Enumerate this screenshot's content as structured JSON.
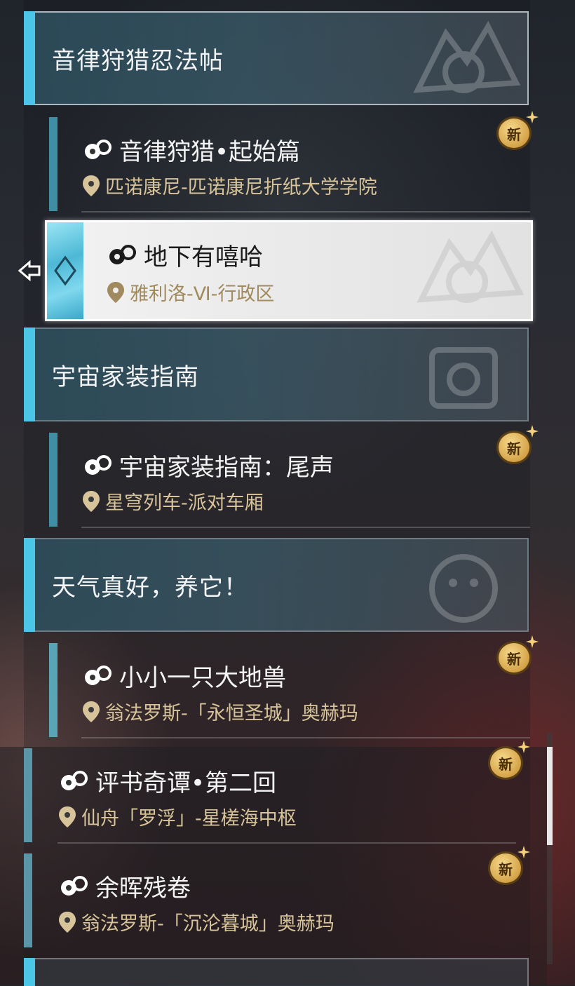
{
  "groups": [
    {
      "title": "音律狩猎忍法帖"
    },
    {
      "title": "宇宙家装指南"
    },
    {
      "title": "天气真好，养它！"
    }
  ],
  "missions": [
    {
      "name": "音律狩猎•起始篇",
      "location": "匹诺康尼-匹诺康尼折纸大学学院",
      "badge": "新"
    },
    {
      "name": "地下有嘻哈",
      "location": "雅利洛-Ⅵ-行政区",
      "badge": ""
    },
    {
      "name": "宇宙家装指南：尾声",
      "location": "星穹列车-派对车厢",
      "badge": "新"
    },
    {
      "name": "小小一只大地兽",
      "location": "翁法罗斯-「永恒圣城」奥赫玛",
      "badge": "新"
    },
    {
      "name": "评书奇谭•第二回",
      "location": "仙舟「罗浮」-星槎海中枢",
      "badge": "新"
    },
    {
      "name": "余晖残卷",
      "location": "翁法罗斯-「沉沦暮城」奥赫玛",
      "badge": "新"
    }
  ],
  "colors": {
    "accent": "#4cc6e6",
    "location_text": "#d8c49a",
    "selected_bg": "#ececec",
    "badge_gold": "#d4a348"
  },
  "icons": {
    "mission": "companion-mission-icon",
    "location": "map-pin-icon",
    "badge": "new-badge-icon"
  }
}
